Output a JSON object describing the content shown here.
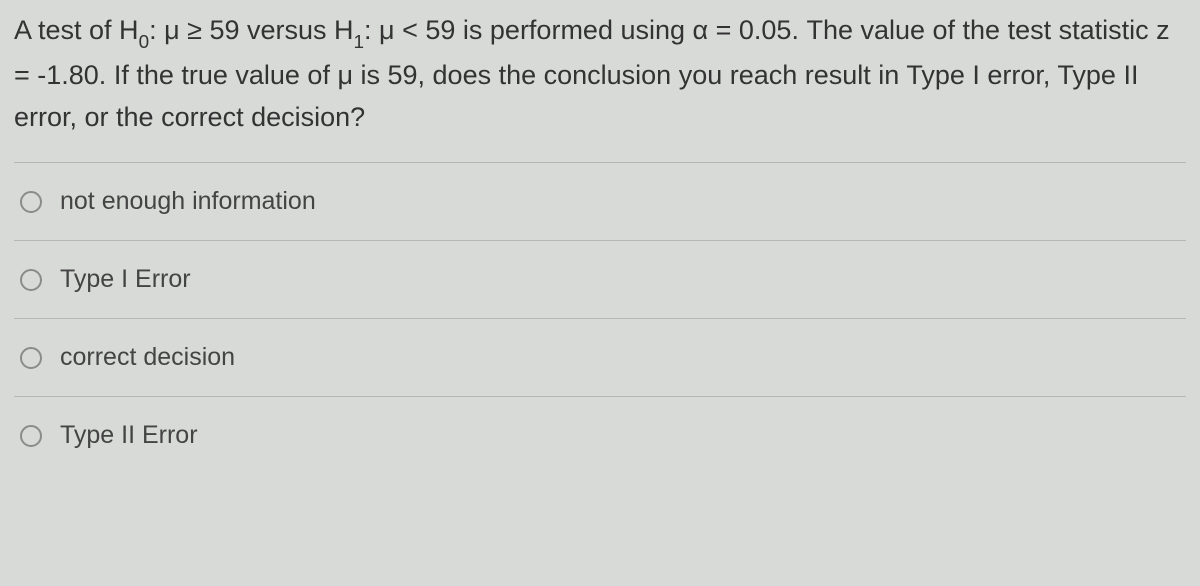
{
  "question": {
    "part1": "A test of H",
    "sub0": "0",
    "part2": ": μ ≥ 59 versus H",
    "sub1": "1",
    "part3": ": μ < 59 is performed using α = 0.05. The value of the test statistic z = -1.80. If the true value of μ is 59, does the conclusion you reach result in Type I error, Type II error, or the correct decision?"
  },
  "options": [
    {
      "label": "not enough information"
    },
    {
      "label": "Type I Error"
    },
    {
      "label": "correct decision"
    },
    {
      "label": "Type II Error"
    }
  ]
}
